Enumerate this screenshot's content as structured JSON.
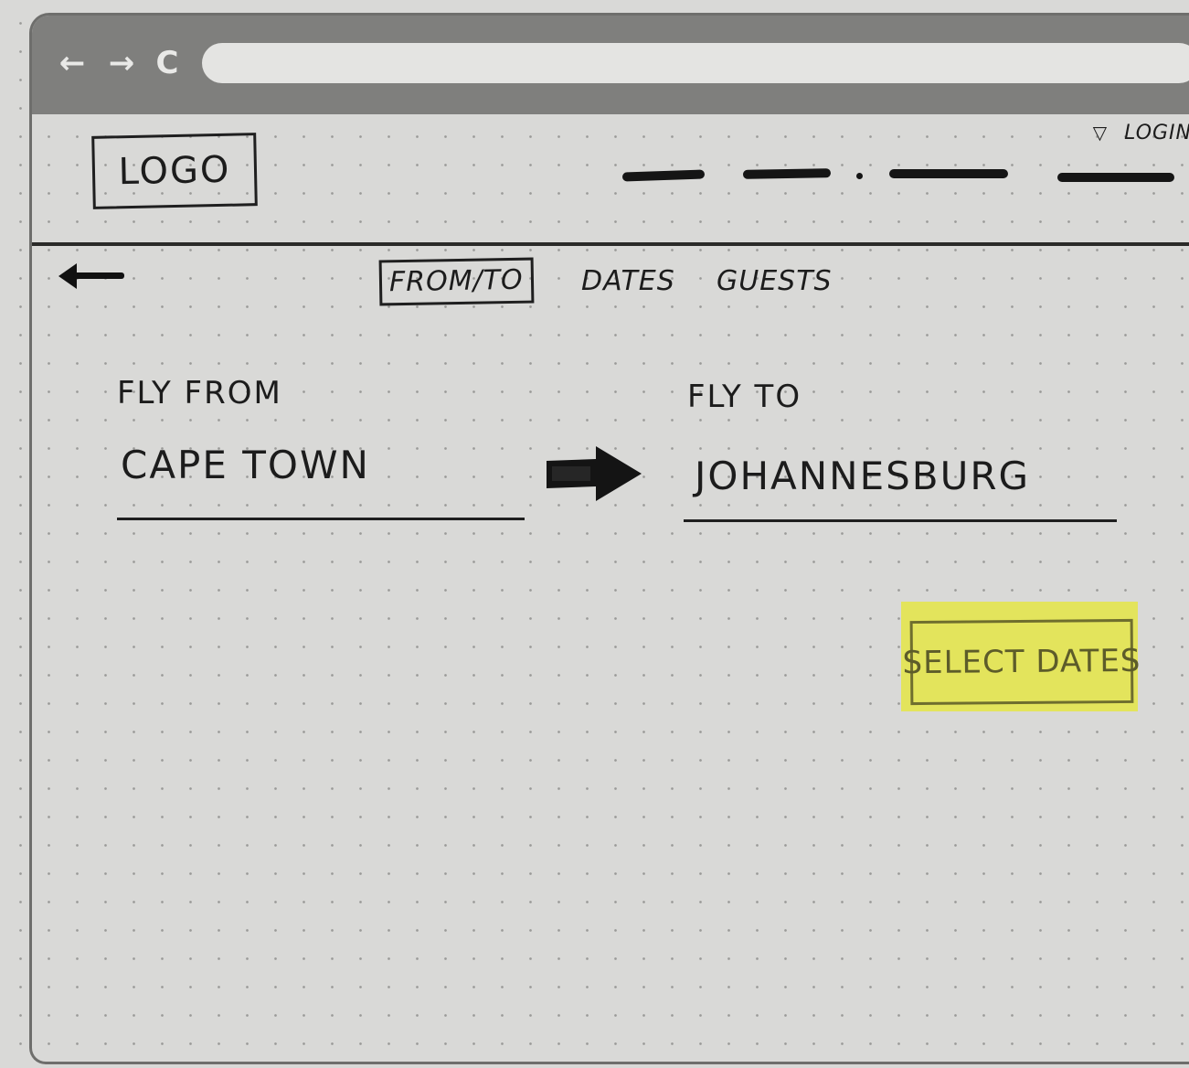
{
  "browser": {
    "back_icon": "←",
    "forward_icon": "→",
    "reload_icon": "C"
  },
  "header": {
    "logo": "LOGO",
    "login_label": "LOGIN",
    "login_icon": "▽"
  },
  "tabs": [
    {
      "label": "FROM/TO",
      "active": true
    },
    {
      "label": "DATES",
      "active": false
    },
    {
      "label": "GUESTS",
      "active": false
    }
  ],
  "form": {
    "from_label": "FLY FROM",
    "from_value": "CAPE TOWN",
    "to_label": "FLY TO",
    "to_value": "JOHANNESBURG"
  },
  "cta": {
    "label": "SELECT DATES",
    "color": "#e3e45c"
  }
}
